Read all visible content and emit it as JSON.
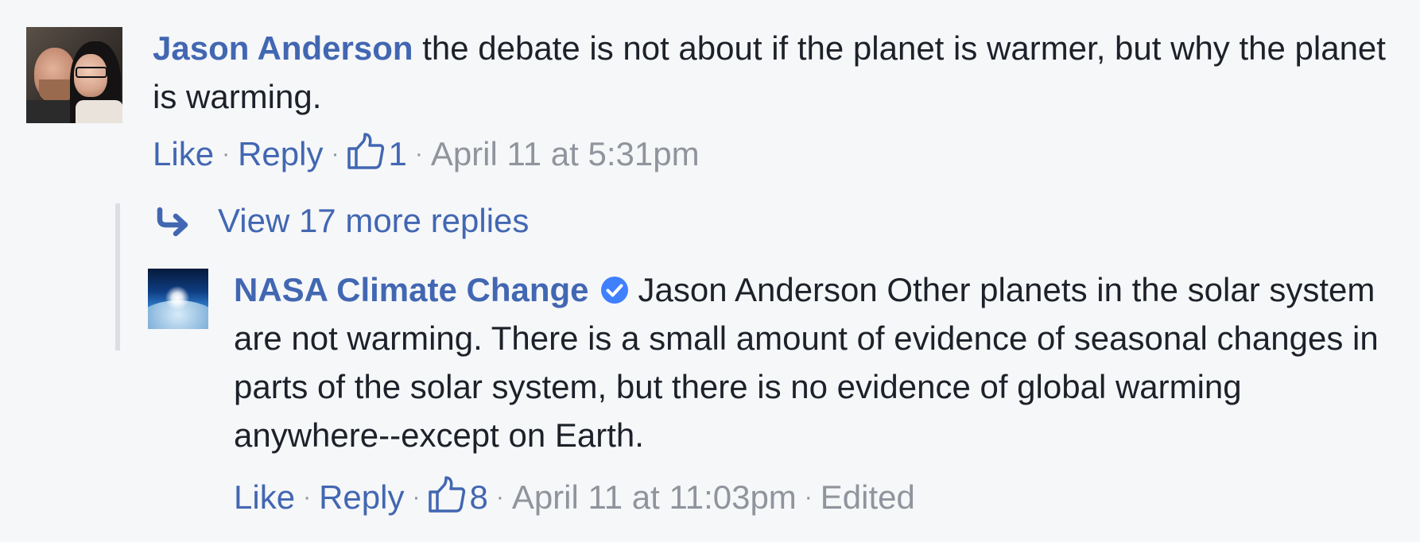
{
  "colors": {
    "background": "#f6f7f9",
    "link": "#4267b2",
    "text": "#1d2129",
    "meta": "#90949c",
    "thread_line": "#dcdee3",
    "verified": "#4080ff"
  },
  "comment": {
    "author": "Jason Anderson",
    "text": "the debate is not about if the planet is warmer, but why the planet is warming.",
    "avatar_icon": "user-profile-photo",
    "actions": {
      "like": "Like",
      "reply": "Reply",
      "separator": "·",
      "like_icon": "thumbs-up-icon",
      "like_count": "1",
      "timestamp": "April 11 at 5:31pm"
    }
  },
  "replies": {
    "view_more_label": "View 17 more replies",
    "view_more_icon": "reply-arrow-icon"
  },
  "reply": {
    "author": "NASA Climate Change",
    "verified_icon": "verified-badge-icon",
    "text": "Jason Anderson Other planets in the solar system are not warming. There is a small amount of evidence of seasonal changes in parts of the solar system, but there is no evidence of global warming anywhere--except on Earth.",
    "avatar_icon": "nasa-earth-horizon-photo",
    "actions": {
      "like": "Like",
      "reply": "Reply",
      "separator": "·",
      "like_icon": "thumbs-up-icon",
      "like_count": "8",
      "timestamp": "April 11 at 11:03pm",
      "edited": "Edited"
    }
  }
}
